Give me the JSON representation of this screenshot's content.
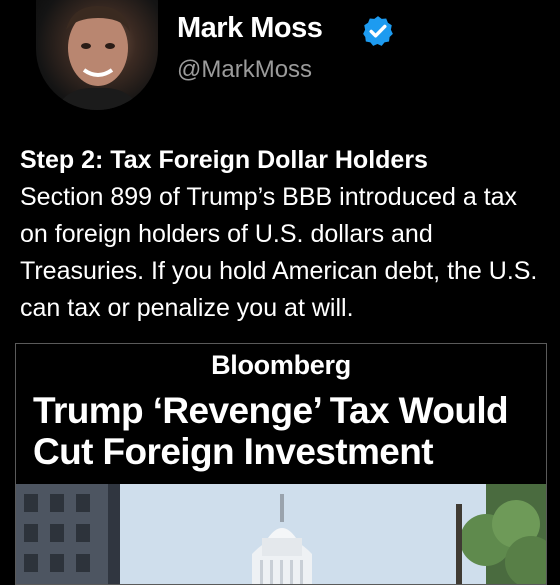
{
  "profile": {
    "name": "Mark Moss",
    "handle": "@MarkMoss",
    "verified_color": "#1d9bf0"
  },
  "tweet": {
    "headline": "Step 2: Tax Foreign Dollar Holders",
    "body": "Section 899 of Trump’s BBB introduced a tax on foreign holders of U.S. dollars and Treasuries. If you hold American debt, the U.S. can tax or penalize you at will."
  },
  "card": {
    "brand": "Bloomberg",
    "title": "Trump ‘Revenge’ Tax Would Cut Foreign Investment"
  }
}
